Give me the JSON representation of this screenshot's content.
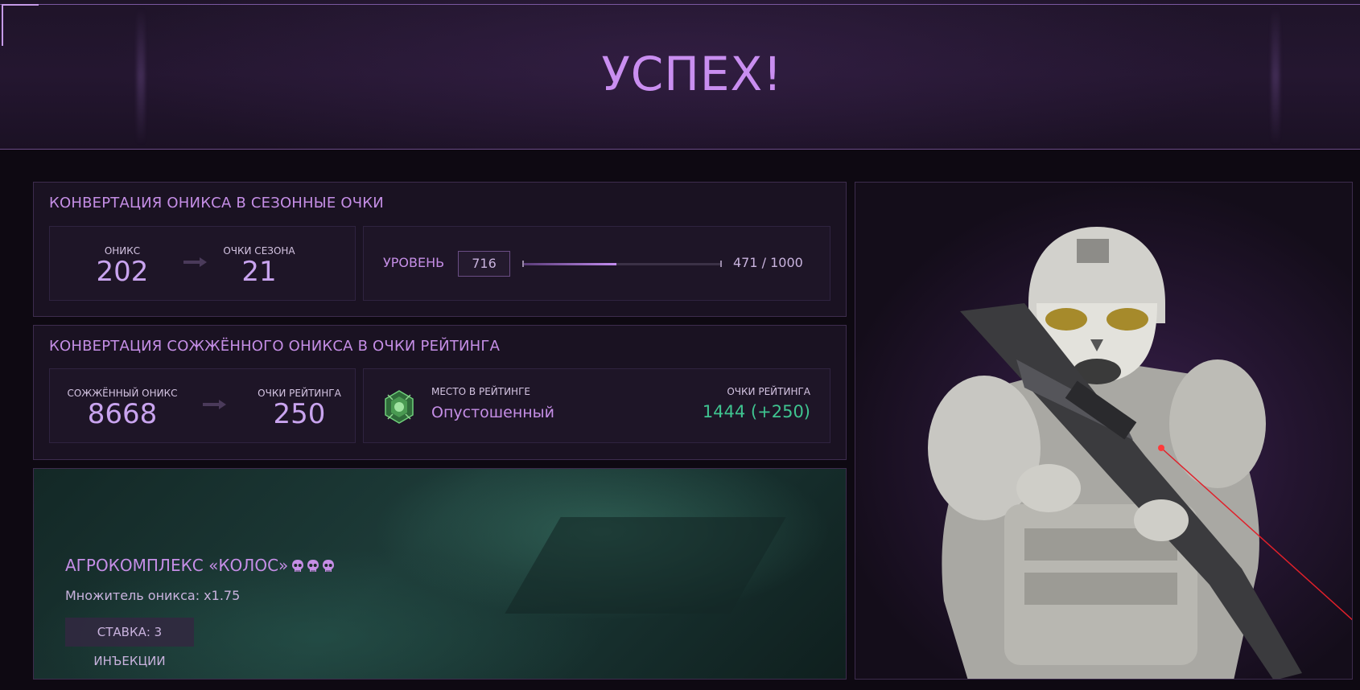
{
  "header": {
    "title": "УСПЕХ!"
  },
  "onyx_conversion": {
    "title": "КОНВЕРТАЦИЯ ОНИКСА В СЕЗОННЫЕ ОЧКИ",
    "onyx_label": "ОНИКС",
    "onyx_value": "202",
    "season_points_label": "ОЧКИ СЕЗОНА",
    "season_points_value": "21",
    "level_label": "УРОВЕНЬ",
    "level_value": "716",
    "progress_text": "471 / 1000",
    "progress_fraction": 0.471
  },
  "burned_conversion": {
    "title": "КОНВЕРТАЦИЯ СОЖЖЁННОГО ОНИКСА В ОЧКИ РЕЙТИНГА",
    "burned_label": "СОЖЖЁННЫЙ ОНИКС",
    "burned_value": "8668",
    "rating_points_label": "ОЧКИ РЕЙТИНГА",
    "rating_points_value": "250",
    "rank_place_label": "МЕСТО В РЕЙТИНГЕ",
    "rank_name": "Опустошенный",
    "total_rating_label": "ОЧКИ РЕЙТИНГА",
    "total_rating_value": "1444 (+250)"
  },
  "map": {
    "name": "АГРОКОМПЛЕКС «КОЛОС»",
    "difficulty_icons": [
      "skull-icon",
      "skull-icon",
      "skull-icon"
    ],
    "multiplier": "Множитель оникса:  x1.75",
    "stake": "СТАВКА: 3 ИНЪЕКЦИИ"
  },
  "colors": {
    "accent": "#c58ee6",
    "rating_green": "#3fc490",
    "background": "#0e0912"
  }
}
